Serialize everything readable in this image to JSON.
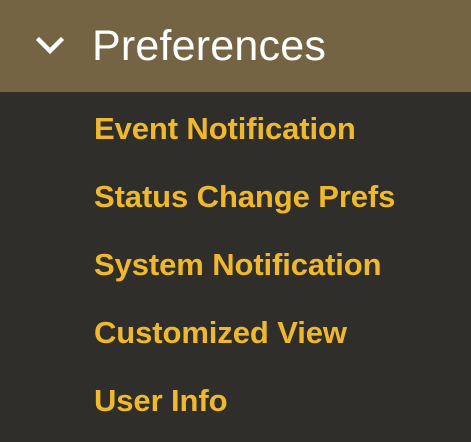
{
  "section": {
    "title": "Preferences",
    "expanded_icon": "chevron-down-icon"
  },
  "colors": {
    "header_bg": "#756444",
    "panel_bg": "#2f2e2b",
    "header_text": "#ffffff",
    "link_text": "#f0b92c"
  },
  "menu": {
    "items": [
      {
        "label": "Event Notification"
      },
      {
        "label": "Status Change Prefs"
      },
      {
        "label": "System Notification"
      },
      {
        "label": "Customized View"
      },
      {
        "label": "User Info"
      }
    ]
  }
}
